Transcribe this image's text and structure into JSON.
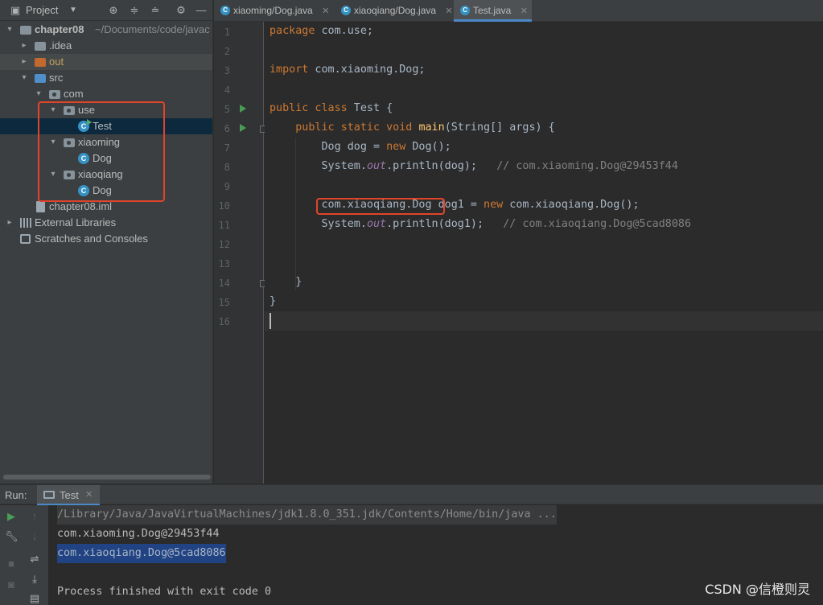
{
  "project_panel": {
    "title": "Project",
    "tree": {
      "root_name": "chapter08",
      "root_path": "~/Documents/code/javac",
      "idea": ".idea",
      "out": "out",
      "src": "src",
      "com": "com",
      "use": "use",
      "test": "Test",
      "xiaoming": "xiaoming",
      "dog1": "Dog",
      "xiaoqiang": "xiaoqiang",
      "dog2": "Dog",
      "iml": "chapter08.iml",
      "external_libraries": "External Libraries",
      "scratches": "Scratches and Consoles"
    }
  },
  "editor": {
    "tabs": [
      {
        "label": "xiaoming/Dog.java",
        "icon": "class-icon"
      },
      {
        "label": "xiaoqiang/Dog.java",
        "icon": "class-icon"
      },
      {
        "label": "Test.java",
        "icon": "class-icon",
        "active": true
      }
    ],
    "line_numbers": [
      "1",
      "2",
      "3",
      "4",
      "5",
      "6",
      "7",
      "8",
      "9",
      "10",
      "11",
      "12",
      "13",
      "14",
      "15",
      "16"
    ],
    "code": {
      "l1_kw": "package",
      "l1_rest": " com.use;",
      "l3_kw": "import",
      "l3_rest": " com.xiaoming.Dog;",
      "l5_kw": "public class",
      "l5_rest": " Test {",
      "l6_kw": "public static void",
      "l6_fn": "main",
      "l6_rest": "(String[] args) {",
      "l7_a": "Dog dog = ",
      "l7_kw": "new",
      "l7_b": " Dog();",
      "l8_a": "System.",
      "l8_st": "out",
      "l8_b": ".println(dog);",
      "l8_cm": "// com.xiaoming.Dog@29453f44",
      "l10_a": "com.xiaoqiang.Dog dog1 = ",
      "l10_kw": "new",
      "l10_b": " com.xiaoqiang.Dog();",
      "l11_a": "System.",
      "l11_st": "out",
      "l11_b": ".println(dog1);",
      "l11_cm": "// com.xiaoqiang.Dog@5cad8086",
      "l14": "}",
      "l15": "}"
    }
  },
  "run_panel": {
    "label": "Run:",
    "tab_label": "Test",
    "console": {
      "cmdline": "/Library/Java/JavaVirtualMachines/jdk1.8.0_351.jdk/Contents/Home/bin/java ...",
      "out1": "com.xiaoming.Dog@29453f44",
      "out2": "com.xiaoqiang.Dog@5cad8086",
      "finish": "Process finished with exit code 0"
    }
  },
  "watermark": "CSDN @信橙则灵",
  "colors": {
    "annotation_red": "#e0442a",
    "selection_blue": "#214283",
    "keyword": "#cc7832"
  }
}
